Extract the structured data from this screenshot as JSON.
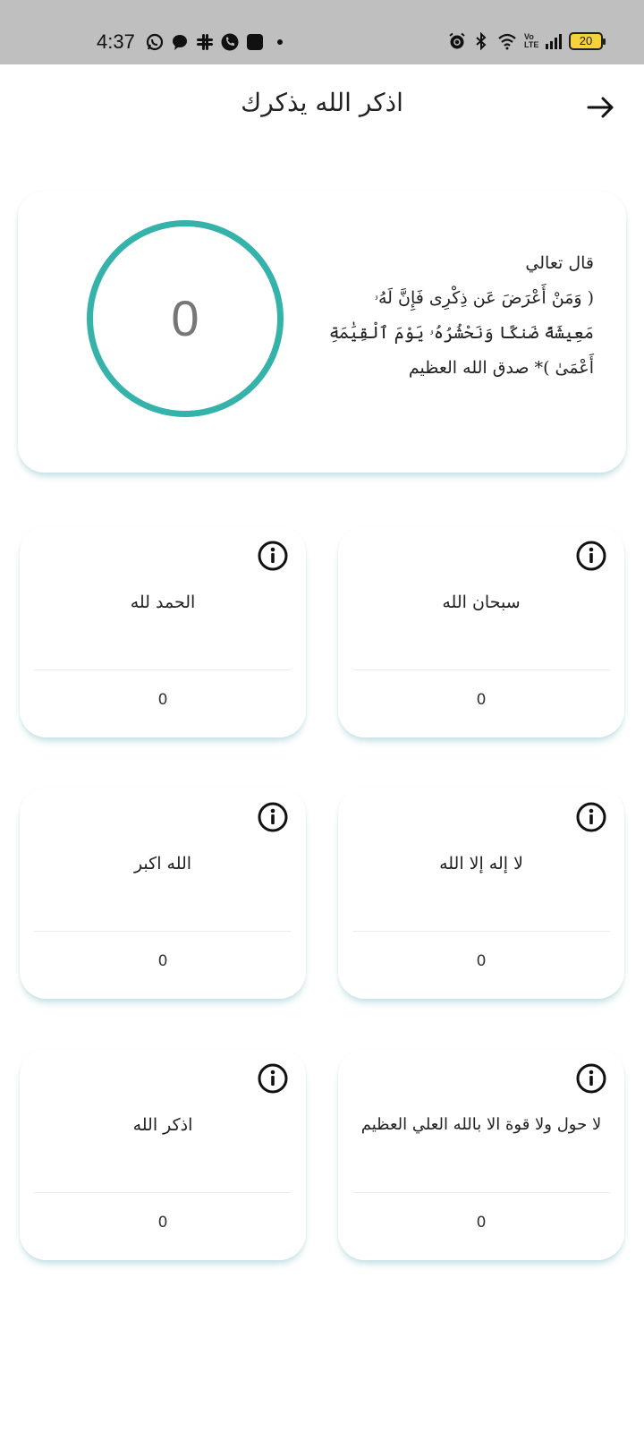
{
  "status_bar": {
    "time": "4:37",
    "battery": "20",
    "left_icons": [
      "whatsapp-icon",
      "chat-icon",
      "slack-icon",
      "phone-icon",
      "app-icon",
      "dot-icon"
    ],
    "right_icons": [
      "alarm-icon",
      "bluetooth-icon",
      "wifi-icon",
      "volte-icon",
      "signal-icon",
      "battery-icon"
    ],
    "volte_text": "Vo LTE"
  },
  "header": {
    "title": "اذكر الله يذكرك",
    "back_icon": "arrow-right-icon"
  },
  "hero": {
    "counter": "0",
    "verse_lines": [
      "قال تعالي",
      "( وَمَنْ أَعْرَضَ عَن ذِكْرِى فَإِنَّ لَهُۥ",
      "مَعِيشَةً ضَنكًا وَنَحْشُرُهُۥ يَوْمَ ٱلْقِيَٰمَةِ",
      "أَعْمَىٰ )* صدق الله العظيم"
    ],
    "ring_color": "#35b2aa"
  },
  "azkar": [
    {
      "label": "سبحان الله",
      "count": "0"
    },
    {
      "label": "الحمد لله",
      "count": "0"
    },
    {
      "label": "لا إله إلا الله",
      "count": "0"
    },
    {
      "label": "الله اكبر",
      "count": "0"
    },
    {
      "label": "لا حول ولا قوة الا بالله العلي العظيم",
      "count": "0"
    },
    {
      "label": "اذكر الله",
      "count": "0"
    }
  ]
}
